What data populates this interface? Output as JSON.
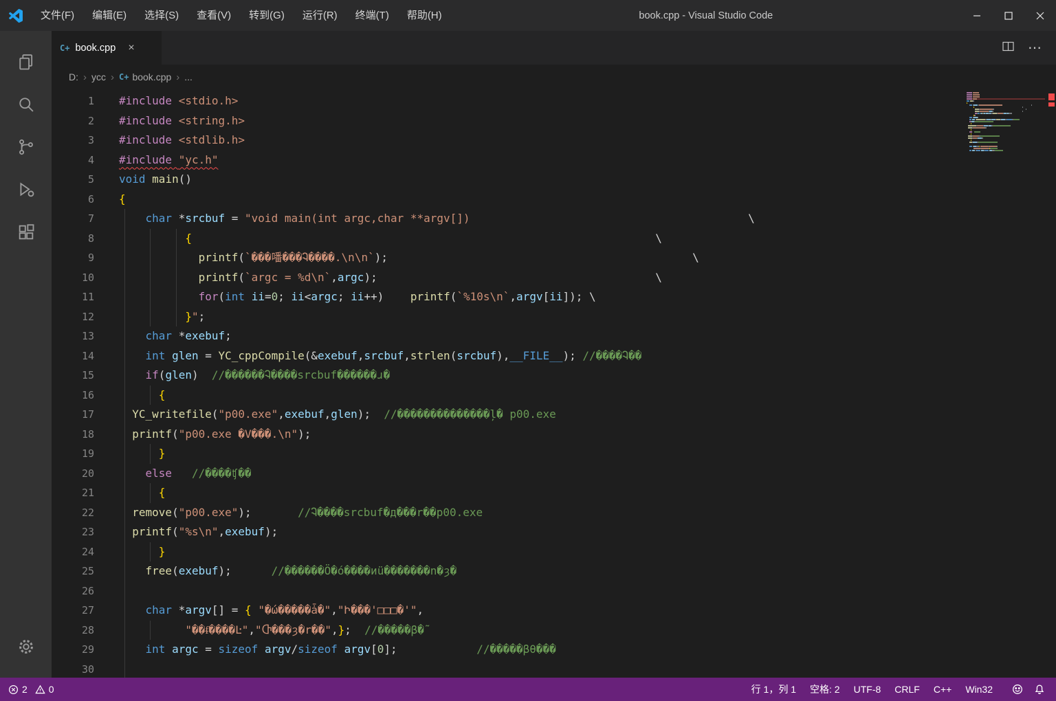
{
  "theme": {
    "titlebar_bg": "#2b2b2c",
    "activitybar_bg": "#333333",
    "tabbar_bg": "#252526",
    "tab_active_bg": "#1e1e1e",
    "editor_bg": "#1e1e1e",
    "statusbar_bg": "#68217a",
    "accent": "#22a2ee",
    "error": "#f14c4c",
    "tok_pp": "#c586c0",
    "tok_kw": "#569cd6",
    "tok_fn": "#dcdcaa",
    "tok_str": "#ce9178",
    "tok_cmt": "#6a9955",
    "tok_var": "#9cdcfe",
    "tok_num": "#b5cea8",
    "tok_br": "#ffd700"
  },
  "titlebar": {
    "title": "book.cpp - Visual Studio Code",
    "menus": [
      "文件(F)",
      "编辑(E)",
      "选择(S)",
      "查看(V)",
      "转到(G)",
      "运行(R)",
      "终端(T)",
      "帮助(H)"
    ]
  },
  "icons": {
    "cpp_glyph": "C+",
    "close_glyph": "×",
    "ellipsis_glyph": "⋯",
    "chevron_glyph": "›"
  },
  "tabs": {
    "active": {
      "label": "book.cpp"
    }
  },
  "breadcrumb": {
    "items": [
      {
        "label": "D:"
      },
      {
        "label": "ycc"
      },
      {
        "label": "book.cpp",
        "icon": "cpp"
      },
      {
        "label": "..."
      }
    ]
  },
  "editor": {
    "lines": [
      {
        "s": [
          [
            "pp",
            "#include"
          ],
          [
            "d",
            " "
          ],
          [
            "str",
            "<stdio.h>"
          ]
        ]
      },
      {
        "s": [
          [
            "pp",
            "#include"
          ],
          [
            "d",
            " "
          ],
          [
            "str",
            "<string.h>"
          ]
        ]
      },
      {
        "s": [
          [
            "pp",
            "#include"
          ],
          [
            "d",
            " "
          ],
          [
            "str",
            "<stdlib.h>"
          ]
        ]
      },
      {
        "sq": true,
        "s": [
          [
            "pp",
            "#include"
          ],
          [
            "d",
            " "
          ],
          [
            "str",
            "\"yc.h\""
          ]
        ]
      },
      {
        "s": [
          [
            "kw",
            "void"
          ],
          [
            "d",
            " "
          ],
          [
            "fn",
            "main"
          ],
          [
            "d",
            "()"
          ]
        ]
      },
      {
        "s": [
          [
            "br",
            "{"
          ]
        ]
      },
      {
        "g": [
          44
        ],
        "s": [
          [
            "d",
            "    "
          ],
          [
            "kw",
            "char"
          ],
          [
            "d",
            " *"
          ],
          [
            "var",
            "srcbuf"
          ],
          [
            "d",
            " = "
          ],
          [
            "str",
            "\"void main(int argc,char **argv[])"
          ],
          [
            "d",
            "                                          \\"
          ]
        ]
      },
      {
        "g": [
          44,
          81,
          119
        ],
        "s": [
          [
            "d",
            "          "
          ],
          [
            "br",
            "{"
          ],
          [
            "d",
            "                                                                      \\"
          ]
        ]
      },
      {
        "g": [
          44,
          81,
          119
        ],
        "s": [
          [
            "d",
            "            "
          ],
          [
            "fn",
            "printf"
          ],
          [
            "d",
            "("
          ],
          [
            "str",
            "`���噃���Ꮈ����.\\n\\n`"
          ],
          [
            "d",
            ");"
          ],
          [
            "d",
            "                                              \\"
          ]
        ]
      },
      {
        "g": [
          44,
          81,
          119
        ],
        "s": [
          [
            "d",
            "            "
          ],
          [
            "fn",
            "printf"
          ],
          [
            "d",
            "("
          ],
          [
            "str",
            "`argc = %d\\n`"
          ],
          [
            "d",
            ","
          ],
          [
            "var",
            "argc"
          ],
          [
            "d",
            ");"
          ],
          [
            "d",
            "                                          \\"
          ]
        ]
      },
      {
        "g": [
          44,
          81,
          119
        ],
        "s": [
          [
            "d",
            "            "
          ],
          [
            "pp",
            "for"
          ],
          [
            "d",
            "("
          ],
          [
            "kw",
            "int"
          ],
          [
            "d",
            " "
          ],
          [
            "var",
            "ii"
          ],
          [
            "d",
            "="
          ],
          [
            "num",
            "0"
          ],
          [
            "d",
            "; "
          ],
          [
            "var",
            "ii"
          ],
          [
            "d",
            "<"
          ],
          [
            "var",
            "argc"
          ],
          [
            "d",
            "; "
          ],
          [
            "var",
            "ii"
          ],
          [
            "d",
            "++)    "
          ],
          [
            "fn",
            "printf"
          ],
          [
            "d",
            "("
          ],
          [
            "str",
            "`%10s\\n`"
          ],
          [
            "d",
            ","
          ],
          [
            "var",
            "argv"
          ],
          [
            "d",
            "["
          ],
          [
            "var",
            "ii"
          ],
          [
            "d",
            "]); \\"
          ]
        ]
      },
      {
        "g": [
          44,
          81,
          119
        ],
        "s": [
          [
            "d",
            "          "
          ],
          [
            "br",
            "}"
          ],
          [
            "str",
            "\""
          ],
          [
            "d",
            ";"
          ]
        ]
      },
      {
        "g": [
          44
        ],
        "s": [
          [
            "d",
            "    "
          ],
          [
            "kw",
            "char"
          ],
          [
            "d",
            " *"
          ],
          [
            "var",
            "exebuf"
          ],
          [
            "d",
            ";"
          ]
        ]
      },
      {
        "g": [
          44
        ],
        "s": [
          [
            "d",
            "    "
          ],
          [
            "kw",
            "int"
          ],
          [
            "d",
            " "
          ],
          [
            "var",
            "glen"
          ],
          [
            "d",
            " = "
          ],
          [
            "fn",
            "YC_cppCompile"
          ],
          [
            "d",
            "(&"
          ],
          [
            "var",
            "exebuf"
          ],
          [
            "d",
            ","
          ],
          [
            "var",
            "srcbuf"
          ],
          [
            "d",
            ","
          ],
          [
            "fn",
            "strlen"
          ],
          [
            "d",
            "("
          ],
          [
            "var",
            "srcbuf"
          ],
          [
            "d",
            "),"
          ],
          [
            "kw",
            "__FILE__"
          ],
          [
            "d",
            "); "
          ],
          [
            "cmt",
            "//����Ꮈ��"
          ]
        ]
      },
      {
        "g": [
          44
        ],
        "s": [
          [
            "d",
            "    "
          ],
          [
            "pp",
            "if"
          ],
          [
            "d",
            "("
          ],
          [
            "var",
            "glen"
          ],
          [
            "d",
            ")  "
          ],
          [
            "cmt",
            "//������Ꮈ����srcbuf������ɹ�"
          ]
        ]
      },
      {
        "g": [
          44,
          81
        ],
        "s": [
          [
            "d",
            "      "
          ],
          [
            "br",
            "{"
          ]
        ]
      },
      {
        "g": [
          44
        ],
        "s": [
          [
            "d",
            "  "
          ],
          [
            "fn",
            "YC_writefile"
          ],
          [
            "d",
            "("
          ],
          [
            "str",
            "\"p00.exe\""
          ],
          [
            "d",
            ","
          ],
          [
            "var",
            "exebuf"
          ],
          [
            "d",
            ","
          ],
          [
            "var",
            "glen"
          ],
          [
            "d",
            ");  "
          ],
          [
            "cmt",
            "//��������������ļ� p00.exe"
          ]
        ]
      },
      {
        "g": [
          44
        ],
        "s": [
          [
            "d",
            "  "
          ],
          [
            "fn",
            "printf"
          ],
          [
            "d",
            "("
          ],
          [
            "str",
            "\"p00.exe �V���.\\n\""
          ],
          [
            "d",
            ");"
          ]
        ]
      },
      {
        "g": [
          44,
          81
        ],
        "s": [
          [
            "d",
            "      "
          ],
          [
            "br",
            "}"
          ]
        ]
      },
      {
        "g": [
          44
        ],
        "s": [
          [
            "d",
            "    "
          ],
          [
            "pp",
            "else"
          ],
          [
            "d",
            "   "
          ],
          [
            "cmt",
            "//����ʧ��"
          ]
        ]
      },
      {
        "g": [
          44,
          81
        ],
        "s": [
          [
            "d",
            "      "
          ],
          [
            "br",
            "{"
          ]
        ]
      },
      {
        "g": [
          44
        ],
        "s": [
          [
            "d",
            "  "
          ],
          [
            "fn",
            "remove"
          ],
          [
            "d",
            "("
          ],
          [
            "str",
            "\"p00.exe\""
          ],
          [
            "d",
            ");       "
          ],
          [
            "cmt",
            "//Ꮈ����srcbuf�д���r��p00.exe"
          ]
        ]
      },
      {
        "g": [
          44
        ],
        "s": [
          [
            "d",
            "  "
          ],
          [
            "fn",
            "printf"
          ],
          [
            "d",
            "("
          ],
          [
            "str",
            "\"%s\\n\""
          ],
          [
            "d",
            ","
          ],
          [
            "var",
            "exebuf"
          ],
          [
            "d",
            ");"
          ]
        ]
      },
      {
        "g": [
          44,
          81
        ],
        "s": [
          [
            "d",
            "      "
          ],
          [
            "br",
            "}"
          ]
        ]
      },
      {
        "g": [
          44
        ],
        "s": [
          [
            "d",
            "    "
          ],
          [
            "fn",
            "free"
          ],
          [
            "d",
            "("
          ],
          [
            "var",
            "exebuf"
          ],
          [
            "d",
            ");      "
          ],
          [
            "cmt",
            "//������Ö�ó����иü�������n�ȝ�"
          ]
        ]
      },
      {
        "g": [
          44
        ],
        "s": []
      },
      {
        "g": [
          44
        ],
        "s": [
          [
            "d",
            "    "
          ],
          [
            "kw",
            "char"
          ],
          [
            "d",
            " *"
          ],
          [
            "var",
            "argv"
          ],
          [
            "d",
            "[] = "
          ],
          [
            "br",
            "{"
          ],
          [
            "d",
            " "
          ],
          [
            "str",
            "\"�ώ�����ǡ�\""
          ],
          [
            "d",
            ","
          ],
          [
            "str",
            "\"Ի���'□□□�'\""
          ],
          [
            "d",
            ","
          ]
        ]
      },
      {
        "g": [
          44,
          81
        ],
        "s": [
          [
            "d",
            "          "
          ],
          [
            "str",
            "\"��ᵮ����Ŀ\""
          ],
          [
            "d",
            ","
          ],
          [
            "str",
            "\"Ⴇ���ȝ�r��\""
          ],
          [
            "d",
            ","
          ],
          [
            "br",
            "}"
          ],
          [
            "d",
            ";  "
          ],
          [
            "cmt",
            "//�����β�˜"
          ]
        ]
      },
      {
        "g": [
          44
        ],
        "s": [
          [
            "d",
            "    "
          ],
          [
            "kw",
            "int"
          ],
          [
            "d",
            " "
          ],
          [
            "var",
            "argc"
          ],
          [
            "d",
            " = "
          ],
          [
            "kw",
            "sizeof"
          ],
          [
            "d",
            " "
          ],
          [
            "var",
            "argv"
          ],
          [
            "d",
            "/"
          ],
          [
            "kw",
            "sizeof"
          ],
          [
            "d",
            " "
          ],
          [
            "var",
            "argv"
          ],
          [
            "d",
            "["
          ],
          [
            "num",
            "0"
          ],
          [
            "d",
            "];            "
          ],
          [
            "cmt",
            "//�����βθ���"
          ]
        ]
      },
      {
        "g": [
          44
        ],
        "s": []
      }
    ]
  },
  "statusbar": {
    "errors": "2",
    "warnings": "0",
    "items_right": [
      {
        "name": "cursor-position",
        "label": "行 1，列 1"
      },
      {
        "name": "indentation",
        "label": "空格: 2"
      },
      {
        "name": "encoding",
        "label": "UTF-8"
      },
      {
        "name": "eol",
        "label": "CRLF"
      },
      {
        "name": "language-mode",
        "label": "C++"
      },
      {
        "name": "platform",
        "label": "Win32"
      }
    ]
  }
}
